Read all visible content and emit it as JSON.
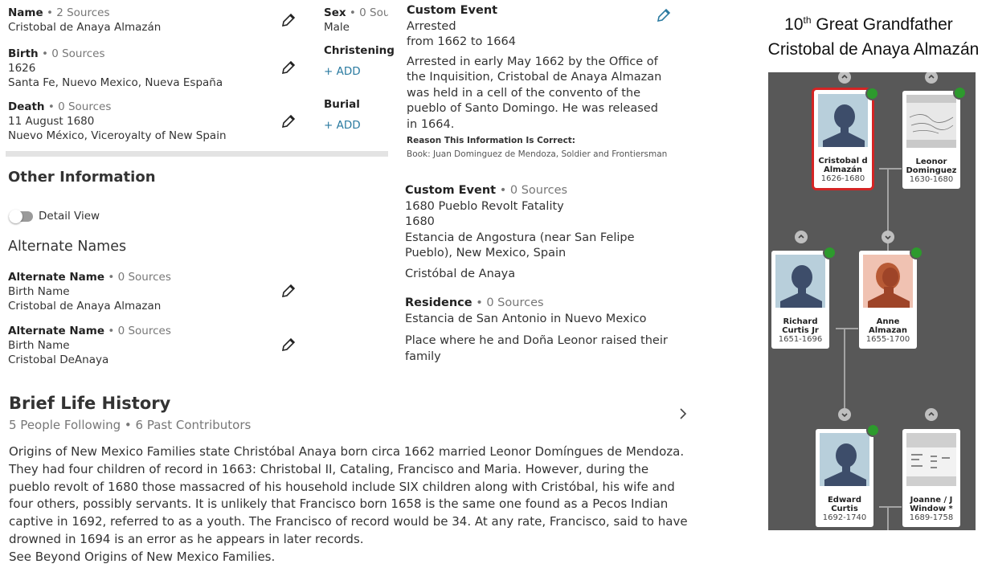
{
  "vitals": {
    "name": {
      "label": "Name",
      "sources": "• 2 Sources",
      "value": "Cristobal de Anaya Almazán"
    },
    "birth": {
      "label": "Birth",
      "sources": "• 0 Sources",
      "date": "1626",
      "place": "Santa Fe, Nuevo Mexico, Nueva España"
    },
    "death": {
      "label": "Death",
      "sources": "• 0 Sources",
      "date": "11 August 1680",
      "place": "Nuevo México, Viceroyalty of New Spain"
    },
    "sex": {
      "label": "Sex",
      "sources": "• 0 Sourc",
      "value": "Male"
    },
    "christening": {
      "label": "Christening",
      "add": "+  ADD"
    },
    "burial": {
      "label": "Burial",
      "add": "+  ADD"
    }
  },
  "other_info": {
    "title": "Other Information",
    "detail_view": "Detail View",
    "alt_names_title": "Alternate Names",
    "alt_names": [
      {
        "label": "Alternate Name",
        "sources": "• 0 Sources",
        "type": "Birth Name",
        "value": "Cristobal de Anaya Almazan"
      },
      {
        "label": "Alternate Name",
        "sources": "• 0 Sources",
        "type": "Birth Name",
        "value": "Cristobal DeAnaya"
      }
    ]
  },
  "events": {
    "custom1": {
      "label": "Custom Event",
      "title": "Arrested",
      "dates": "from 1662 to 1664",
      "desc": "Arrested in early May 1662 by the Office of the Inquisition, Cristobal de Anaya Almazan was held in a cell of the convento of the pueblo of Santo Domingo. He was released in 1664.",
      "reason_label": "Reason This Information Is Correct:",
      "reason": "Book: Juan Dominguez de Mendoza, Soldier and Frontiersman"
    },
    "custom2": {
      "label": "Custom Event",
      "sources": "• 0 Sources",
      "title": "1680 Pueblo Revolt Fatality",
      "date": "1680",
      "place": "Estancia de Angostura (near San Felipe Pueblo), New Mexico, Spain",
      "note": "Cristóbal de Anaya"
    },
    "residence": {
      "label": "Residence",
      "sources": "• 0 Sources",
      "place": "Estancia de San Antonio in Nuevo Mexico",
      "note": "Place where he and Doña Leonor raised their family"
    }
  },
  "life_history": {
    "title": "Brief Life History",
    "meta": "5 People Following • 6 Past Contributors",
    "body": "Origins of New Mexico Families state Christóbal Anaya born circa 1662 married Leonor Domíngues de Mendoza. They had four children of record in 1663: Christobal II, Cataling, Francisco and Maria.  However, during the pueblo revolt of 1680 those massacred of his household include SIX children along with Cristóbal, his wife and four others, possibly servants.   It is unlikely that Francisco born 1658 is the same one found as a Pecos Indian captive in 1692, referred to as a youth.  The Francisco of record would be 34. At any rate, Francisco, said to have drowned in 1694 is an error as he appears in later records.",
    "see_also": "See Beyond Origins of New Mexico Families."
  },
  "tree_title": {
    "ordinal": "10",
    "sup": "th",
    "rest": " Great Grandfather",
    "name": "Cristobal de Anaya Almazán"
  },
  "tree": {
    "people": [
      {
        "name1": "Cristobal d",
        "name2": "Almazán",
        "years": "1626-1680",
        "photo": "male-silhouette",
        "selected": true
      },
      {
        "name1": "Leonor",
        "name2": "Dominguez",
        "years": "1630-1680",
        "photo": "document-image"
      },
      {
        "name1": "Richard",
        "name2": "Curtis Jr",
        "years": "1651-1696",
        "photo": "male-silhouette"
      },
      {
        "name1": "Anne",
        "name2": "Almazan",
        "years": "1655-1700",
        "photo": "female-silhouette"
      },
      {
        "name1": "Edward",
        "name2": "Curtis",
        "years": "1692-1740",
        "photo": "male-silhouette"
      },
      {
        "name1": "Joanne / J",
        "name2": "Window *",
        "years": "1689-1758",
        "photo": "document-image"
      }
    ],
    "colors": {
      "bg": "#585858",
      "selected": "#d42424",
      "badge": "#2d9a2d",
      "male_bg": "#b8cfdb",
      "female_bg": "#f0c2b2"
    }
  }
}
